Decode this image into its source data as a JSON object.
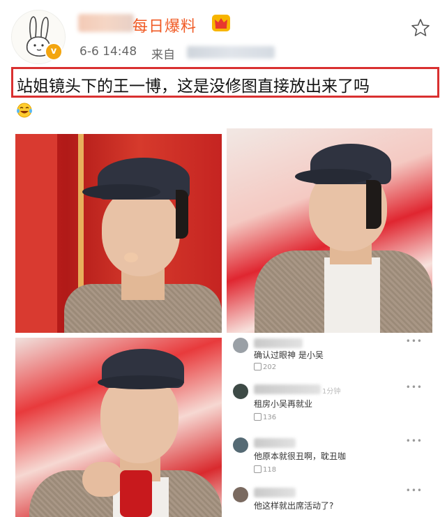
{
  "post": {
    "account_name": "每日爆料",
    "time": "6-6 14:48",
    "source_label": "来自",
    "caption": "站姐镜头下的王一博，这是没修图直接放出来了吗",
    "badge_letter": "v",
    "emoji": "laugh-cry-emoji"
  },
  "colors": {
    "name_color": "#f05a24",
    "highlight_border": "#d93030",
    "badge_color": "#f3a50f"
  },
  "comments": [
    {
      "text": "确认过眼神 是小吴",
      "likes": "202",
      "time": ""
    },
    {
      "text": "租房小吴再就业",
      "likes": "136",
      "time": "1分钟"
    },
    {
      "text": "他原本就很丑啊，耽丑咖",
      "likes": "118",
      "time": ""
    },
    {
      "text": "他这样就出席活动了?",
      "likes": "",
      "time": ""
    }
  ],
  "icons": {
    "star": "star-outline-icon",
    "crown": "crown-icon",
    "more": "more-dots-icon",
    "like": "thumb-up-icon"
  }
}
